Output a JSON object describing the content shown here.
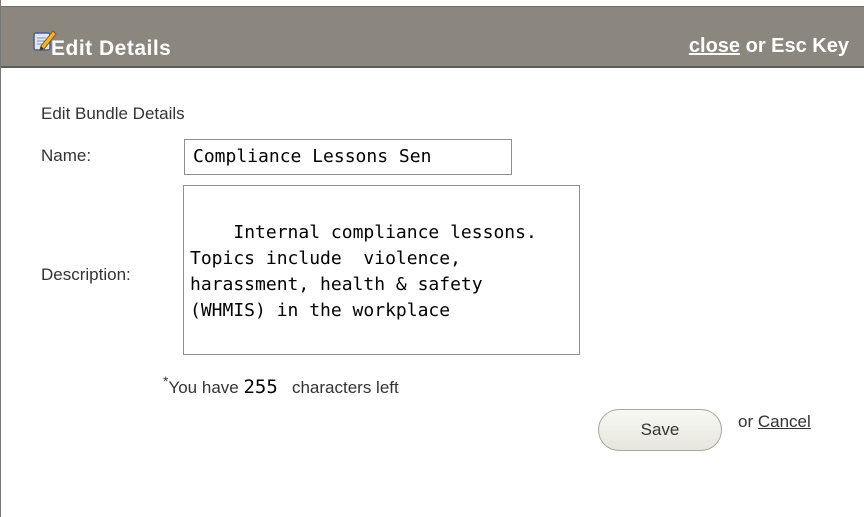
{
  "dialog": {
    "title": "Edit Details",
    "close_label": "close",
    "close_suffix": " or Esc Key",
    "icon": "edit-pencil-icon"
  },
  "form": {
    "section_heading": "Edit Bundle Details",
    "name_label": "Name:",
    "name_value": "Compliance Lessons Sen",
    "description_label": "Description:",
    "description_value": "Internal compliance lessons.\nTopics include  violence,\nharassment, health & safety\n(WHMIS) in the workplace",
    "asterisk": "*",
    "chars_prefix": "You have ",
    "chars_count": "255",
    "chars_suffix": "   characters left",
    "save_label": "Save",
    "or_text": "or ",
    "cancel_label": "Cancel"
  }
}
